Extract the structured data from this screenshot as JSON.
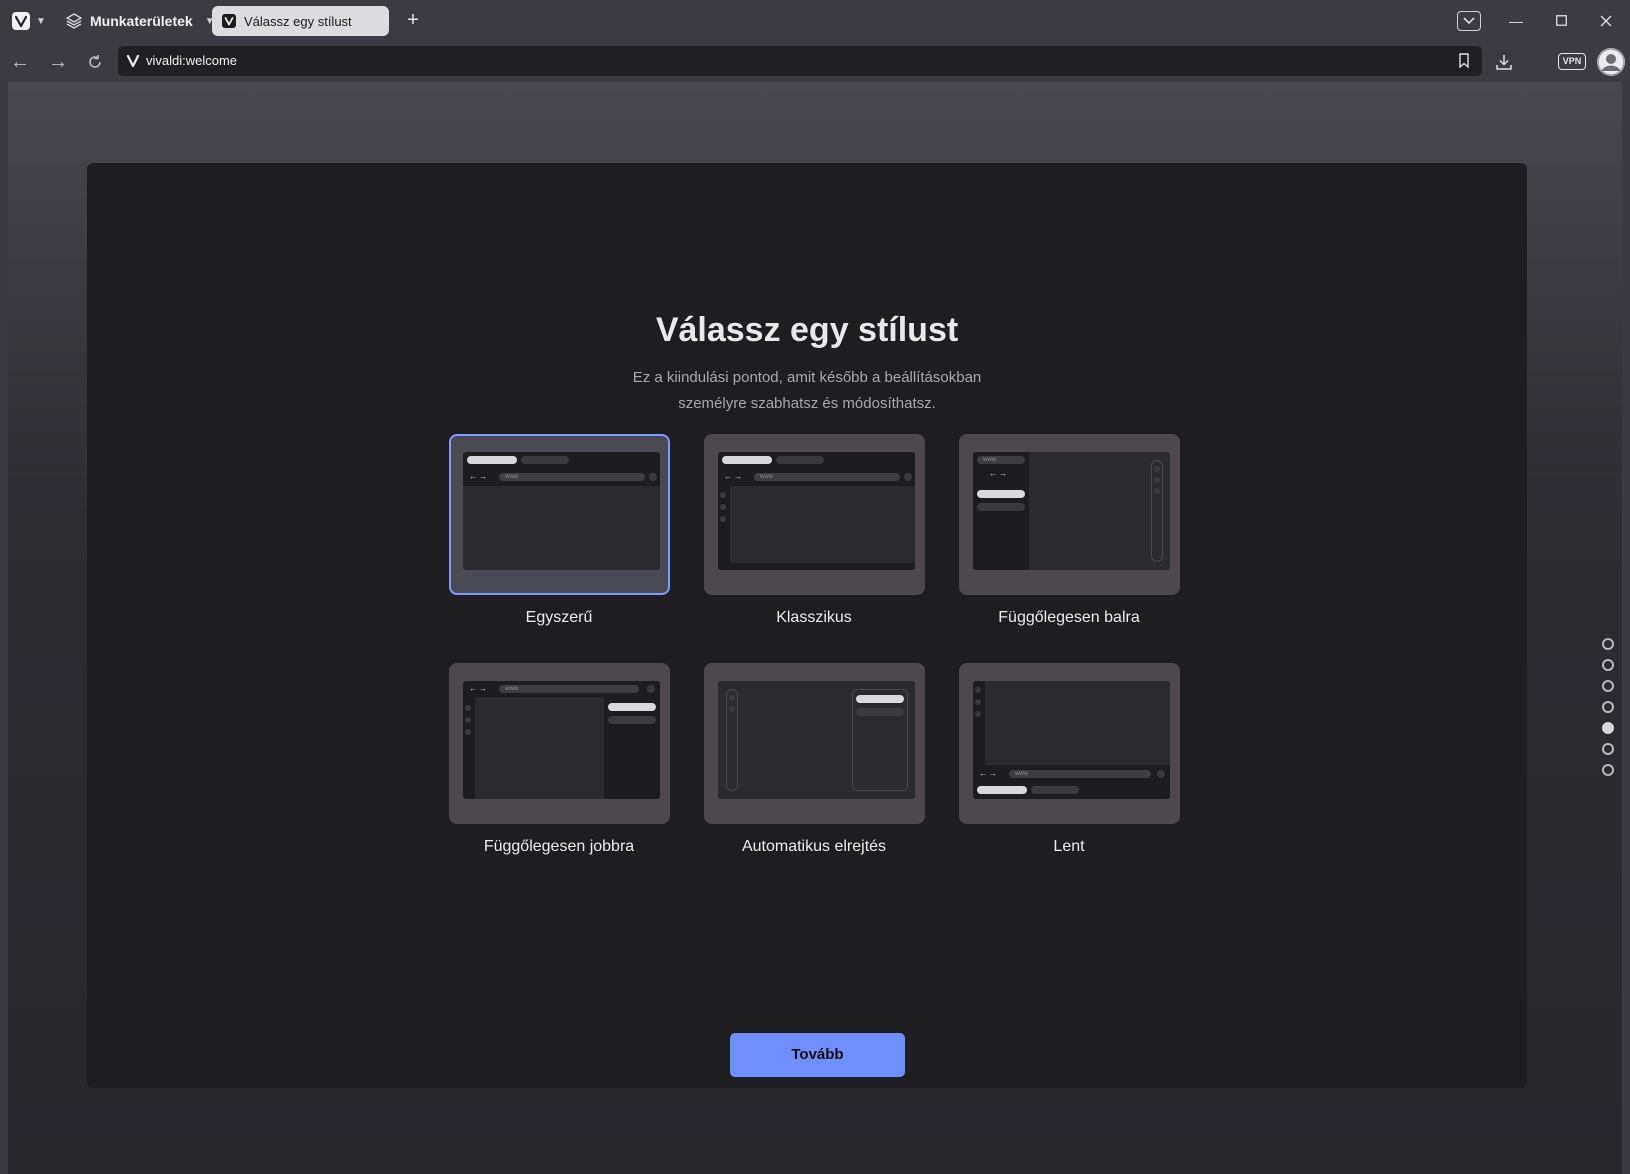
{
  "browser": {
    "workspaces_label": "Munkaterületek",
    "active_tab_title": "Válassz egy stílust",
    "url": "vivaldi:welcome",
    "vpn_label": "VPN"
  },
  "page": {
    "title": "Válassz egy stílust",
    "subtitle_line1": "Ez a kiindulási pontod, amit később a beállításokban",
    "subtitle_line2": "személyre szabhatsz és módosíthatsz.",
    "url_placeholder": "www",
    "styles": [
      {
        "label": "Egyszerű",
        "selected": true
      },
      {
        "label": "Klasszikus",
        "selected": false
      },
      {
        "label": "Függőlegesen balra",
        "selected": false
      },
      {
        "label": "Függőlegesen jobbra",
        "selected": false
      },
      {
        "label": "Automatikus elrejtés",
        "selected": false
      },
      {
        "label": "Lent",
        "selected": false
      }
    ],
    "continue_label": "Tovább",
    "pager": {
      "total": 7,
      "active_index": 4
    }
  },
  "colors": {
    "accent": "#6f8fff",
    "selected_border": "#7f9bff",
    "panel_bg": "#1e1e20"
  }
}
